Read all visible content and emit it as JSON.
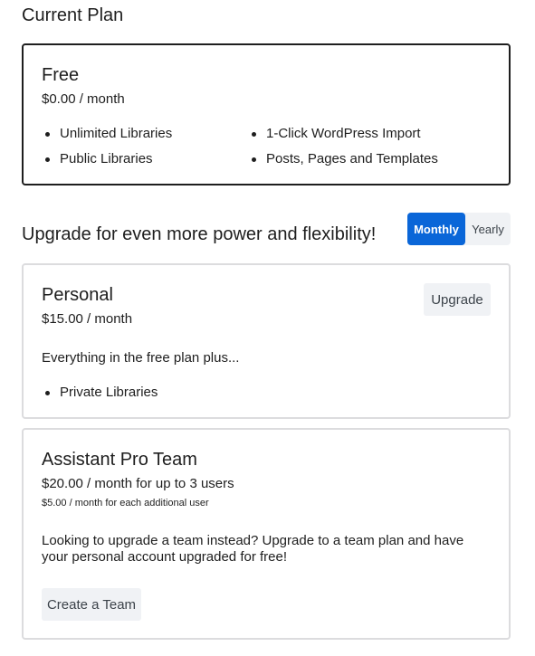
{
  "current_plan": {
    "section_title": "Current Plan",
    "name": "Free",
    "price": "$0.00 / month",
    "features_left": [
      "Unlimited Libraries",
      "Public Libraries"
    ],
    "features_right": [
      "1-Click WordPress Import",
      "Posts, Pages and Templates"
    ]
  },
  "upgrade": {
    "section_title": "Upgrade for even more power and flexibility!",
    "billing_toggle": {
      "monthly_label": "Monthly",
      "yearly_label": "Yearly",
      "selected": "Monthly"
    }
  },
  "personal_plan": {
    "name": "Personal",
    "price": "$15.00 / month",
    "upgrade_label": "Upgrade",
    "description": "Everything in the free plan plus...",
    "features": [
      "Private Libraries"
    ]
  },
  "team_plan": {
    "name": "Assistant Pro Team",
    "price": "$20.00 / month for up to 3 users",
    "additional_user_note": "$5.00 / month for each additional user",
    "description": "Looking to upgrade a team instead? Upgrade to a team plan and have your personal account upgraded for free!",
    "create_team_label": "Create a Team"
  },
  "colors": {
    "accent": "#0a66d8",
    "current_border": "#1e1e1e",
    "card_border": "#dcdcde",
    "secondary_button_bg": "#f0f2f5"
  }
}
